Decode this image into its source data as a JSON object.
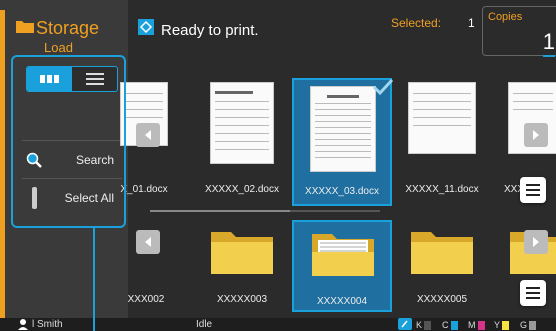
{
  "left": {
    "title": "Storage",
    "subtitle": "Load",
    "search_label": "Search",
    "select_all_label": "Select All"
  },
  "topbar": {
    "status": "Ready to print.",
    "selected_label": "Selected:",
    "selected_count": "1",
    "copies_label": "Copies",
    "copies_value": "1"
  },
  "files": [
    {
      "name": "X_01.docx"
    },
    {
      "name": "XXXXX_02.docx"
    },
    {
      "name": "XXXXX_03.docx",
      "selected": true
    },
    {
      "name": "XXXXX_11.docx"
    },
    {
      "name": "XXX"
    }
  ],
  "folders": [
    {
      "name": "XXX002"
    },
    {
      "name": "XXXXX003"
    },
    {
      "name": "XXXXX004",
      "selected": true
    },
    {
      "name": "XXXXX005"
    }
  ],
  "bottombar": {
    "user": "l Smith",
    "machine_status": "Idle",
    "ink_labels": [
      "K",
      "C",
      "M",
      "Y",
      "G"
    ]
  },
  "colors": {
    "accent": "#1aa1dc",
    "brand_orange": "#f0a020",
    "background": "#2b2b2b",
    "ink_K": "#333333",
    "ink_C": "#1aa1dc",
    "ink_M": "#d6338a",
    "ink_Y": "#f5e342",
    "ink_G": "#999999"
  }
}
